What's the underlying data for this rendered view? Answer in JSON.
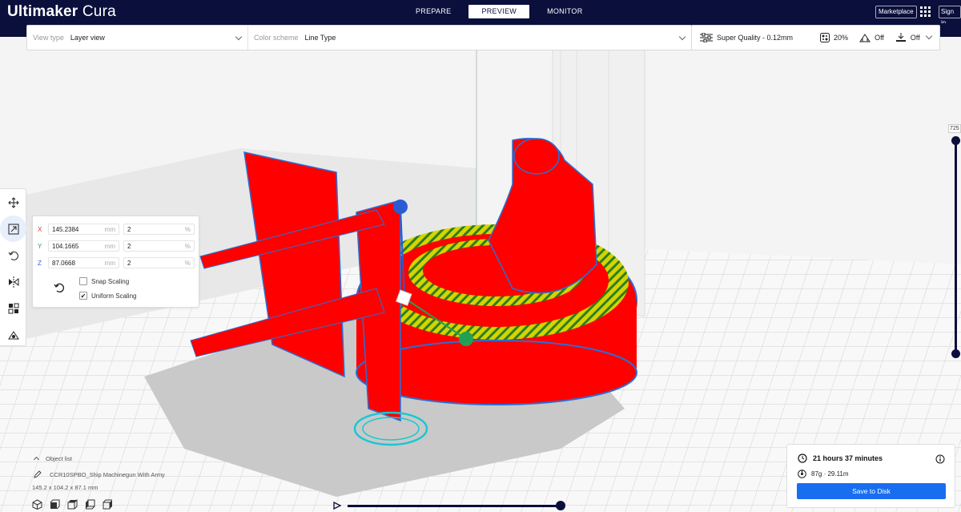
{
  "app": {
    "title_bold": "Ultimaker",
    "title_light": " Cura"
  },
  "stages": [
    {
      "label": "PREPARE"
    },
    {
      "label": "PREVIEW"
    },
    {
      "label": "MONITOR"
    }
  ],
  "header": {
    "marketplace": "Marketplace",
    "signin": "Sign in"
  },
  "viewbar": {
    "view_type_label": "View type",
    "view_type_value": "Layer view",
    "color_scheme_label": "Color scheme",
    "color_scheme_value": "Line Type"
  },
  "print_settings": {
    "profile": "Super Quality - 0.12mm",
    "infill": "20%",
    "support": "Off",
    "adhesion": "Off"
  },
  "scale_panel": {
    "x": {
      "axis": "X",
      "mm": "145.2384",
      "percent": "2"
    },
    "y": {
      "axis": "Y",
      "mm": "104.1665",
      "percent": "2"
    },
    "z": {
      "axis": "Z",
      "mm": "87.0668",
      "percent": "2"
    },
    "unit_mm": "mm",
    "unit_pct": "%",
    "snap_scaling": "Snap Scaling",
    "uniform_scaling": "Uniform Scaling",
    "snap_checked": false,
    "uniform_checked": true
  },
  "layer_slider": {
    "current_layer": "725",
    "level": 1.0
  },
  "simulation": {
    "progress": 1.0
  },
  "object_list": {
    "header": "Object list",
    "object_name": "CCR10SPBO_Ship Machinegun With Army",
    "dimensions": "145.2 x 104.2 x 87.1 mm"
  },
  "job": {
    "time": "21 hours 37 minutes",
    "material": "87g · 29.11m",
    "save_button": "Save to Disk"
  },
  "colors": {
    "header_bg": "#0a0f3c",
    "accent": "#196ef0",
    "model_red": "#ff0000",
    "infill_yellow": "#d4d400"
  }
}
